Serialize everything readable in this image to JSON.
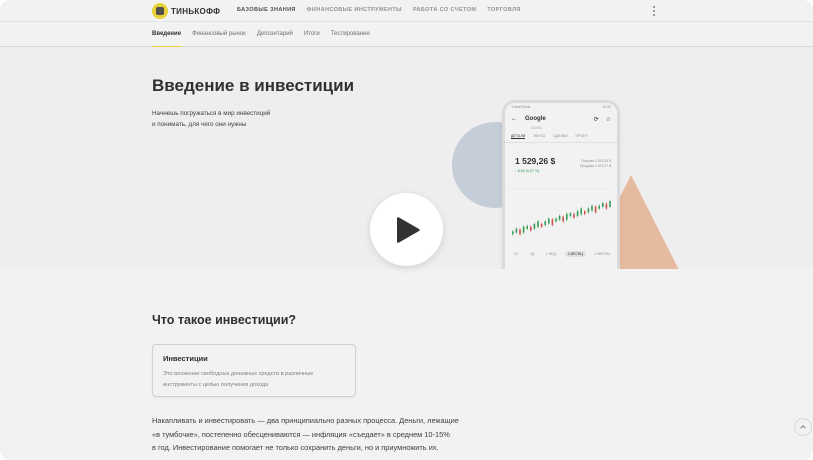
{
  "brand": {
    "name": "ТИНЬКОФФ"
  },
  "topnav": {
    "links": [
      {
        "label": "БАЗОВЫЕ ЗНАНИЯ",
        "active": true
      },
      {
        "label": "ФИНАНСОВЫЕ ИНСТРУМЕНТЫ",
        "active": false
      },
      {
        "label": "РАБОТА СО СЧЕТОМ",
        "active": false
      },
      {
        "label": "ТОРГОВЛЯ",
        "active": false
      }
    ],
    "more_icon": "more-vertical-icon"
  },
  "subnav": {
    "tabs": [
      {
        "label": "Введение",
        "active": true
      },
      {
        "label": "Финансовый рынок",
        "active": false
      },
      {
        "label": "Депозитарий",
        "active": false
      },
      {
        "label": "Итоги",
        "active": false
      },
      {
        "label": "Тестирование",
        "active": false
      }
    ]
  },
  "hero": {
    "title": "Введение в инвестиции",
    "description_line1": "Начнешь погружаться в мир инвестиций",
    "description_line2": "и понимать, для чего они нужны",
    "circle_color": "#d0d8e4",
    "triangle_color": "#f3c5a8"
  },
  "phone": {
    "status_left": "Tinkoff Bank",
    "status_right": "12:00",
    "back_icon": "arrow-left-icon",
    "stock_name": "Google",
    "stock_sub": "GOOG",
    "icons": [
      "refresh-icon",
      "star-icon"
    ],
    "tabs": [
      {
        "label": "ДЕТАЛИ",
        "active": true
      },
      {
        "label": "ЛЕНТА",
        "active": false
      },
      {
        "label": "СДЕЛКИ",
        "active": false
      },
      {
        "label": "ПРОГН",
        "active": false
      }
    ],
    "price": "1 529,26 $",
    "change": "↑ 8,69 (0,57 %)",
    "buy_label": "Покупка 1 529,26 $",
    "sell_label": "Продажа 1 529,27 $",
    "periods": [
      {
        "label": "1Ч",
        "active": false
      },
      {
        "label": "1Д",
        "active": false
      },
      {
        "label": "1 НЕД",
        "active": false
      },
      {
        "label": "1 МЕСЯЦ",
        "active": true
      },
      {
        "label": "1 МЕСЯЦ",
        "active": false
      }
    ]
  },
  "content": {
    "section_title": "Что такое инвестиции?",
    "definition_title": "Инвестиции",
    "definition_line1": "Это вложение свободных денежных средств в различные",
    "definition_line2": "инструменты с целью получения дохода",
    "paragraph_line1": "Накапливать и инвестировать — два принципиально разных процесса. Деньги, лежащие",
    "paragraph_line2": "«в тумбочке», постепенно обесцениваются — инфляция «съедает» в среднем 10-15%",
    "paragraph_line3": "в год. Инвестирование помогает не только сохранить деньги, но и приумножить их."
  },
  "video": {
    "play_icon": "play-icon"
  },
  "scroll_top": {
    "icon": "chevron-up-icon"
  }
}
